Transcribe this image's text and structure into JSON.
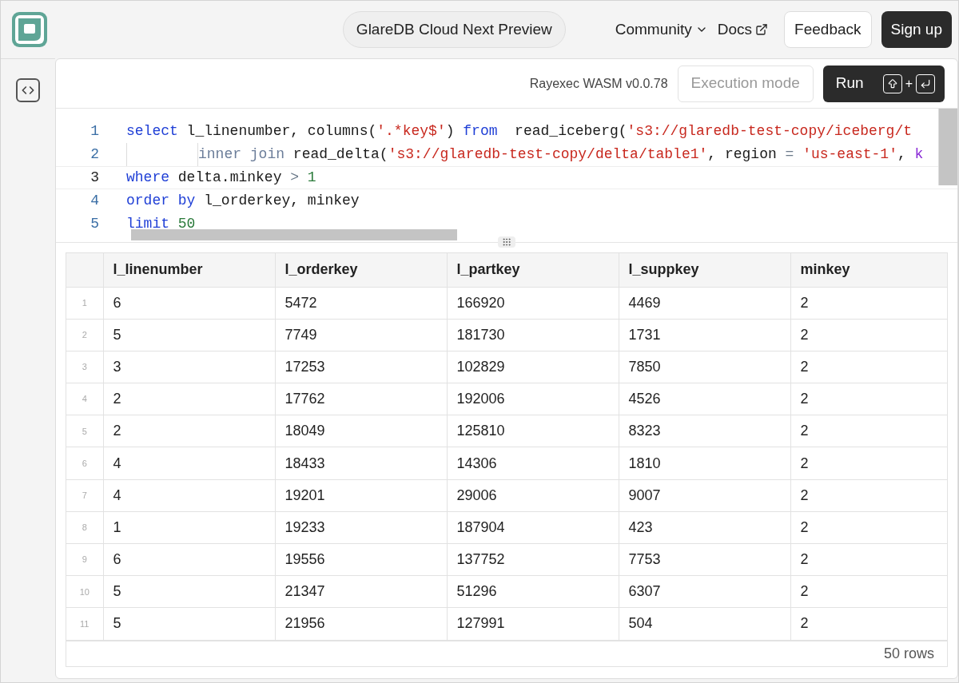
{
  "header": {
    "preview_badge": "GlareDB Cloud Next Preview",
    "nav": [
      {
        "kind": "menu",
        "label": "Community"
      },
      {
        "kind": "external",
        "label": "Docs"
      }
    ],
    "feedback_button": "Feedback",
    "signup_button": "Sign up"
  },
  "toolbar": {
    "version": "Rayexec WASM v0.0.78",
    "mode_placeholder": "Execution mode",
    "run_button": "Run",
    "shortcut_plus": "+"
  },
  "editor": {
    "lines": [
      {
        "number": "1",
        "active": false,
        "indent": false,
        "tokens": [
          {
            "kind": "keyword",
            "text": "select"
          },
          {
            "kind": "plain",
            "text": " l_linenumber, columns("
          },
          {
            "kind": "string",
            "text": "'.*key$'"
          },
          {
            "kind": "plain",
            "text": ") "
          },
          {
            "kind": "keyword",
            "text": "from"
          },
          {
            "kind": "plain",
            "text": "  read_iceberg("
          },
          {
            "kind": "string",
            "text": "'s3://glaredb-test-copy/iceberg/t"
          }
        ]
      },
      {
        "number": "2",
        "active": false,
        "indent": true,
        "tokens": [
          {
            "kind": "muted",
            "text": "inner join"
          },
          {
            "kind": "plain",
            "text": " read_delta("
          },
          {
            "kind": "string",
            "text": "'s3://glaredb-test-copy/delta/table1'"
          },
          {
            "kind": "plain",
            "text": ", region "
          },
          {
            "kind": "operator",
            "text": "= "
          },
          {
            "kind": "string",
            "text": "'us-east-1'"
          },
          {
            "kind": "plain",
            "text": ", "
          },
          {
            "kind": "param",
            "text": "k"
          }
        ]
      },
      {
        "number": "3",
        "active": true,
        "indent": false,
        "tokens": [
          {
            "kind": "keyword",
            "text": "where"
          },
          {
            "kind": "plain",
            "text": " delta.minkey "
          },
          {
            "kind": "operator",
            "text": "> "
          },
          {
            "kind": "number",
            "text": "1"
          }
        ]
      },
      {
        "number": "4",
        "active": false,
        "indent": false,
        "tokens": [
          {
            "kind": "keyword",
            "text": "order by"
          },
          {
            "kind": "plain",
            "text": " l_orderkey, minkey"
          }
        ]
      },
      {
        "number": "5",
        "active": false,
        "indent": false,
        "tokens": [
          {
            "kind": "keyword",
            "text": "limit "
          },
          {
            "kind": "number",
            "text": "50"
          }
        ]
      }
    ]
  },
  "table": {
    "columns": [
      "l_linenumber",
      "l_orderkey",
      "l_partkey",
      "l_suppkey",
      "minkey"
    ],
    "rows": [
      {
        "index": "1",
        "cells": [
          "6",
          "5472",
          "166920",
          "4469",
          "2"
        ]
      },
      {
        "index": "2",
        "cells": [
          "5",
          "7749",
          "181730",
          "1731",
          "2"
        ]
      },
      {
        "index": "3",
        "cells": [
          "3",
          "17253",
          "102829",
          "7850",
          "2"
        ]
      },
      {
        "index": "4",
        "cells": [
          "2",
          "17762",
          "192006",
          "4526",
          "2"
        ]
      },
      {
        "index": "5",
        "cells": [
          "2",
          "18049",
          "125810",
          "8323",
          "2"
        ]
      },
      {
        "index": "6",
        "cells": [
          "4",
          "18433",
          "14306",
          "1810",
          "2"
        ]
      },
      {
        "index": "7",
        "cells": [
          "4",
          "19201",
          "29006",
          "9007",
          "2"
        ]
      },
      {
        "index": "8",
        "cells": [
          "1",
          "19233",
          "187904",
          "423",
          "2"
        ]
      },
      {
        "index": "9",
        "cells": [
          "6",
          "19556",
          "137752",
          "7753",
          "2"
        ]
      },
      {
        "index": "10",
        "cells": [
          "5",
          "21347",
          "51296",
          "6307",
          "2"
        ]
      },
      {
        "index": "11",
        "cells": [
          "5",
          "21956",
          "127991",
          "504",
          "2"
        ]
      }
    ],
    "row_count": "50 rows"
  }
}
